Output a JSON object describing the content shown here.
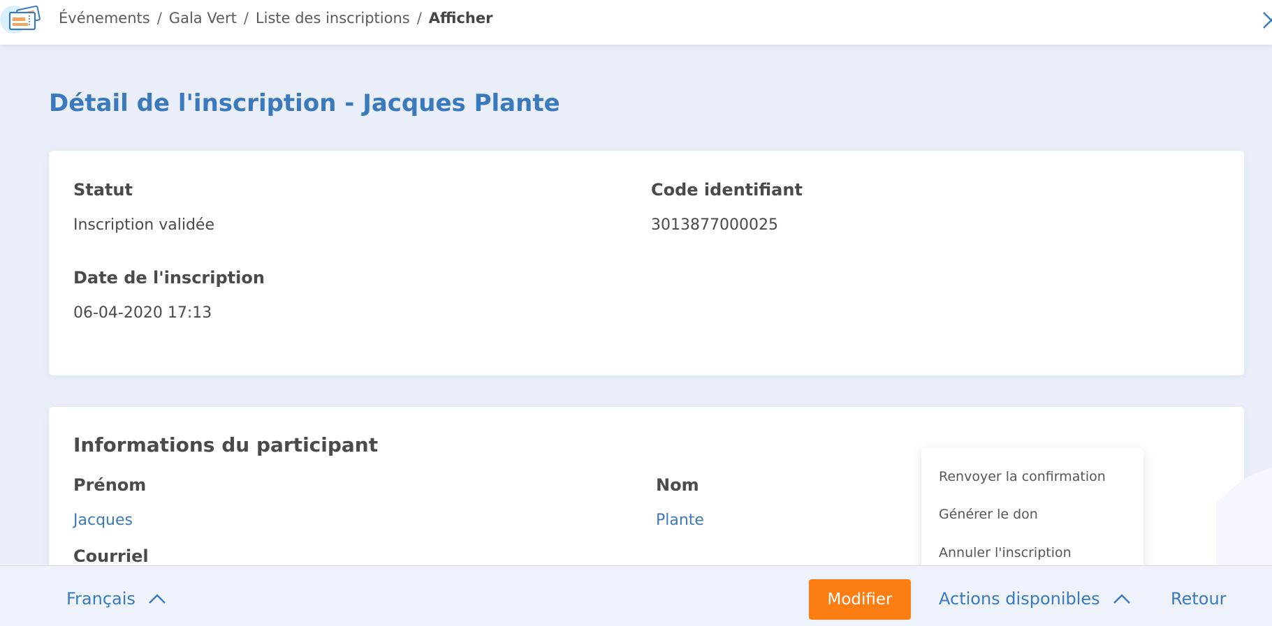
{
  "breadcrumb": {
    "items": [
      "Événements",
      "Gala Vert",
      "Liste des inscriptions"
    ],
    "current": "Afficher",
    "separator": "/"
  },
  "page": {
    "title": "Détail de l'inscription - Jacques Plante"
  },
  "registration": {
    "status_label": "Statut",
    "status_value": "Inscription validée",
    "code_label": "Code identifiant",
    "code_value": "3013877000025",
    "date_label": "Date de l'inscription",
    "date_value": "06-04-2020 17:13"
  },
  "participant": {
    "section_title": "Informations du participant",
    "firstname_label": "Prénom",
    "firstname_value": "Jacques",
    "lastname_label": "Nom",
    "lastname_value": "Plante",
    "email_label": "Courriel"
  },
  "actions_menu": {
    "items": [
      "Renvoyer la confirmation",
      "Générer le don",
      "Annuler l'inscription"
    ]
  },
  "footer": {
    "language": "Français",
    "modify_label": "Modifier",
    "actions_label": "Actions disponibles",
    "back_label": "Retour"
  },
  "colors": {
    "accent": "#3b79bd",
    "primary_button": "#fb7d13",
    "background": "#e9eef9"
  },
  "icons": {
    "logo": "ticket-icon",
    "close": "close-icon",
    "chevron": "chevron-up-icon"
  }
}
